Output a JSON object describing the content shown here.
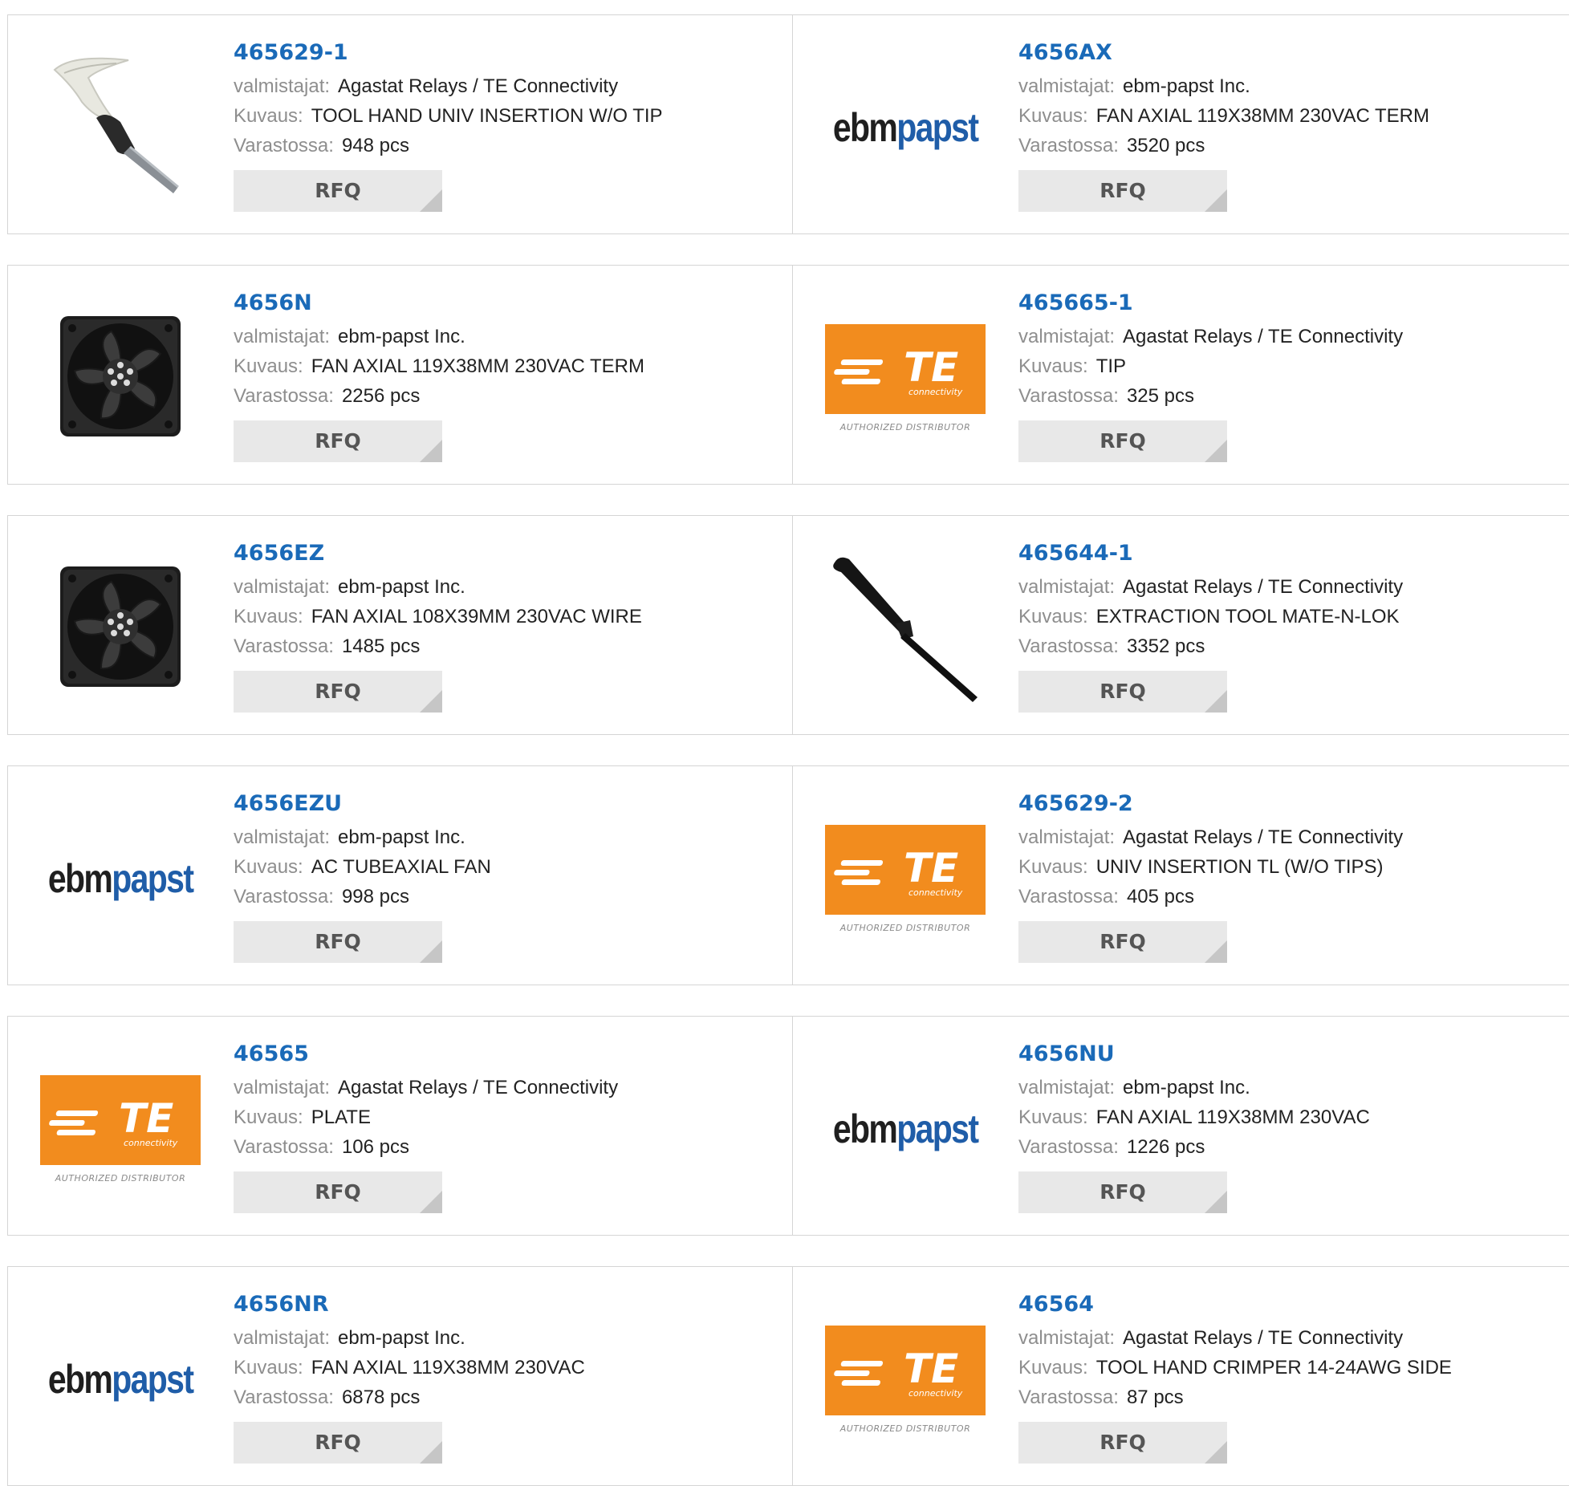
{
  "labels": {
    "manufacturer": "valmistajat:",
    "description": "Kuvaus:",
    "stock": "Varastossa:",
    "rfq": "RFQ"
  },
  "logos": {
    "ebm_part1": "ebm",
    "ebm_part2": "papst",
    "te_letters": "TE",
    "te_sub": "connectivity",
    "te_distributor": "AUTHORIZED DISTRIBUTOR"
  },
  "colors": {
    "part_link": "#1a6ab8",
    "te_orange": "#f28c1e",
    "ebm_blue": "#1f5da8"
  },
  "products": [
    {
      "part": "465629-1",
      "manufacturer": "Agastat Relays / TE Connectivity",
      "description": "TOOL HAND UNIV INSERTION W/O TIP",
      "stock": "948 pcs",
      "image": "insertion-tool-photo"
    },
    {
      "part": "4656AX",
      "manufacturer": "ebm-papst Inc.",
      "description": "FAN AXIAL 119X38MM 230VAC TERM",
      "stock": "3520 pcs",
      "image": "ebmpapst-logo"
    },
    {
      "part": "4656N",
      "manufacturer": "ebm-papst Inc.",
      "description": "FAN AXIAL 119X38MM 230VAC TERM",
      "stock": "2256 pcs",
      "image": "fan-photo"
    },
    {
      "part": "465665-1",
      "manufacturer": "Agastat Relays / TE Connectivity",
      "description": "TIP",
      "stock": "325 pcs",
      "image": "te-logo"
    },
    {
      "part": "4656EZ",
      "manufacturer": "ebm-papst Inc.",
      "description": "FAN AXIAL 108X39MM 230VAC WIRE",
      "stock": "1485 pcs",
      "image": "fan-photo"
    },
    {
      "part": "465644-1",
      "manufacturer": "Agastat Relays / TE Connectivity",
      "description": "EXTRACTION TOOL MATE-N-LOK",
      "stock": "3352 pcs",
      "image": "extraction-tool-photo"
    },
    {
      "part": "4656EZU",
      "manufacturer": "ebm-papst Inc.",
      "description": "AC TUBEAXIAL FAN",
      "stock": "998 pcs",
      "image": "ebmpapst-logo"
    },
    {
      "part": "465629-2",
      "manufacturer": "Agastat Relays / TE Connectivity",
      "description": "UNIV INSERTION TL (W/O TIPS)",
      "stock": "405 pcs",
      "image": "te-logo"
    },
    {
      "part": "46565",
      "manufacturer": "Agastat Relays / TE Connectivity",
      "description": "PLATE",
      "stock": "106 pcs",
      "image": "te-logo"
    },
    {
      "part": "4656NU",
      "manufacturer": "ebm-papst Inc.",
      "description": "FAN AXIAL 119X38MM 230VAC",
      "stock": "1226 pcs",
      "image": "ebmpapst-logo"
    },
    {
      "part": "4656NR",
      "manufacturer": "ebm-papst Inc.",
      "description": "FAN AXIAL 119X38MM 230VAC",
      "stock": "6878 pcs",
      "image": "ebmpapst-logo"
    },
    {
      "part": "46564",
      "manufacturer": "Agastat Relays / TE Connectivity",
      "description": "TOOL HAND CRIMPER 14-24AWG SIDE",
      "stock": "87 pcs",
      "image": "te-logo"
    }
  ]
}
